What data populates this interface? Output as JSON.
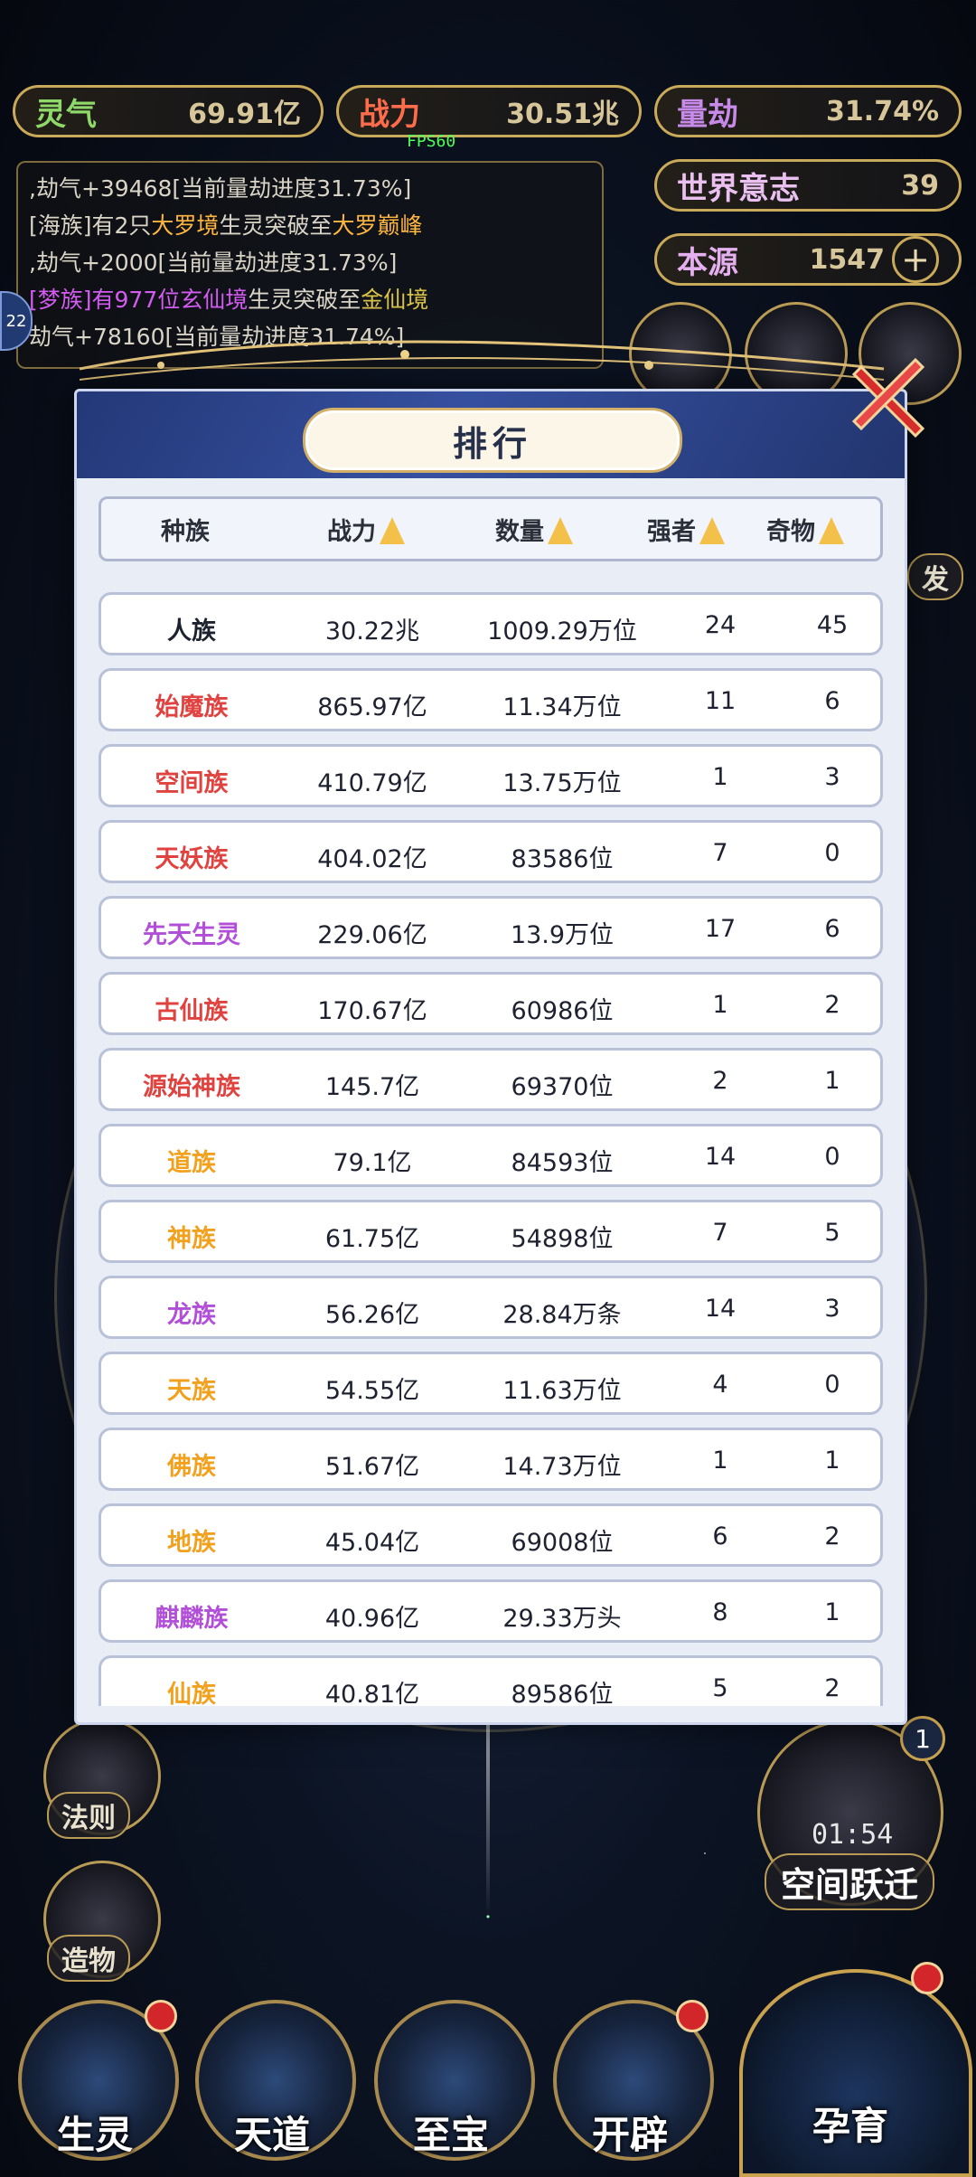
{
  "top_bar": {
    "lingqi": {
      "label": "灵气",
      "value": "69.91亿"
    },
    "zhanli": {
      "label": "战力",
      "value": "30.51兆"
    },
    "liangjie": {
      "label": "量劫",
      "value": "31.74%"
    },
    "shijieyizhi": {
      "label": "世界意志",
      "value": "39"
    },
    "benyuan": {
      "label": "本源",
      "value": "1547"
    },
    "fps": "FPS60"
  },
  "log": {
    "line1": ",劫气+39468[当前量劫进度31.73%]",
    "line2_prefix": "[海族]有2只",
    "line2_hl1": "大罗境",
    "line2_mid": "生灵突破至",
    "line2_hl2": "大罗巅峰",
    "line3": ",劫气+2000[当前量劫进度31.73%]",
    "line4_prefix": "[梦族]有977位",
    "line4_hl": "玄仙境",
    "line4_mid": "生灵突破至",
    "line4_hl2": "金仙境",
    "line5": "劫气+78160[当前量劫进度31.74%]"
  },
  "side": {
    "left_badge": "22",
    "right_top": "发",
    "fa_ze": "法则",
    "zao_wu": "造物",
    "timer": "01:54",
    "portal": "空间跃迁",
    "portal_badge": "1"
  },
  "dialog": {
    "title": "排行",
    "headers": {
      "race": "种族",
      "power": "战力",
      "count": "数量",
      "strong": "强者",
      "treasure": "奇物"
    },
    "rows": [
      {
        "name": "人族",
        "color": "#1e2230",
        "power": "30.22兆",
        "count": "1009.29万位",
        "strong": "24",
        "treasure": "45"
      },
      {
        "name": "始魔族",
        "color": "#e0433f",
        "power": "865.97亿",
        "count": "11.34万位",
        "strong": "11",
        "treasure": "6"
      },
      {
        "name": "空间族",
        "color": "#e0433f",
        "power": "410.79亿",
        "count": "13.75万位",
        "strong": "1",
        "treasure": "3"
      },
      {
        "name": "天妖族",
        "color": "#e0433f",
        "power": "404.02亿",
        "count": "83586位",
        "strong": "7",
        "treasure": "0"
      },
      {
        "name": "先天生灵",
        "color": "#b14fd8",
        "power": "229.06亿",
        "count": "13.9万位",
        "strong": "17",
        "treasure": "6"
      },
      {
        "name": "古仙族",
        "color": "#e0433f",
        "power": "170.67亿",
        "count": "60986位",
        "strong": "1",
        "treasure": "2"
      },
      {
        "name": "源始神族",
        "color": "#e0433f",
        "power": "145.7亿",
        "count": "69370位",
        "strong": "2",
        "treasure": "1"
      },
      {
        "name": "道族",
        "color": "#f2a11f",
        "power": "79.1亿",
        "count": "84593位",
        "strong": "14",
        "treasure": "0"
      },
      {
        "name": "神族",
        "color": "#f2a11f",
        "power": "61.75亿",
        "count": "54898位",
        "strong": "7",
        "treasure": "5"
      },
      {
        "name": "龙族",
        "color": "#b14fd8",
        "power": "56.26亿",
        "count": "28.84万条",
        "strong": "14",
        "treasure": "3"
      },
      {
        "name": "天族",
        "color": "#f2a11f",
        "power": "54.55亿",
        "count": "11.63万位",
        "strong": "4",
        "treasure": "0"
      },
      {
        "name": "佛族",
        "color": "#f2a11f",
        "power": "51.67亿",
        "count": "14.73万位",
        "strong": "1",
        "treasure": "1"
      },
      {
        "name": "地族",
        "color": "#f2a11f",
        "power": "45.04亿",
        "count": "69008位",
        "strong": "6",
        "treasure": "2"
      },
      {
        "name": "麒麟族",
        "color": "#b14fd8",
        "power": "40.96亿",
        "count": "29.33万头",
        "strong": "8",
        "treasure": "1"
      },
      {
        "name": "仙族",
        "color": "#f2a11f",
        "power": "40.81亿",
        "count": "89586位",
        "strong": "5",
        "treasure": "2"
      }
    ]
  },
  "bottom_nav": {
    "shengling": "生灵",
    "tiandao": "天道",
    "zhibao": "至宝",
    "kaipi": "开辟",
    "yunyu": "孕育"
  }
}
